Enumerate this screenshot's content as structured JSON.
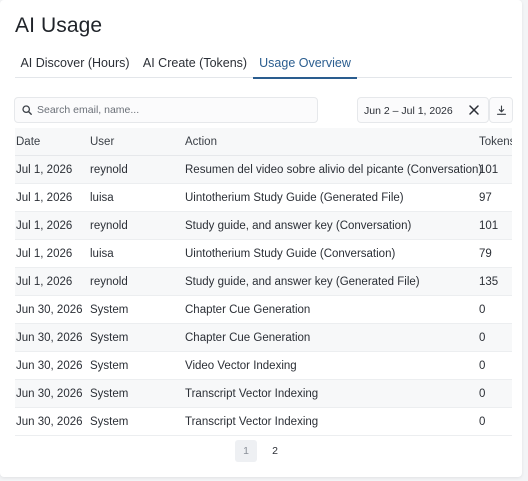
{
  "page": {
    "title": "AI Usage"
  },
  "tabs": [
    {
      "label": "AI Discover (Hours)"
    },
    {
      "label": "AI Create (Tokens)"
    },
    {
      "label": "Usage Overview"
    }
  ],
  "search": {
    "placeholder": "Search email, name..."
  },
  "date_range": {
    "value": "Jun 2 – Jul 1, 2026"
  },
  "table": {
    "headers": {
      "date": "Date",
      "user": "User",
      "action": "Action",
      "tokens": "Tokens"
    },
    "rows": [
      {
        "date": "Jul 1, 2026",
        "user": "reynold",
        "action": "Resumen del video sobre alivio del picante (Conversation)",
        "tokens": "101"
      },
      {
        "date": "Jul 1, 2026",
        "user": "luisa",
        "action": "Uintotherium Study Guide (Generated File)",
        "tokens": "97"
      },
      {
        "date": "Jul 1, 2026",
        "user": "reynold",
        "action": "Study guide,          and answer key (Conversation)",
        "tokens": "101"
      },
      {
        "date": "Jul 1, 2026",
        "user": "luisa",
        "action": "Uintotherium Study Guide (Conversation)",
        "tokens": "79"
      },
      {
        "date": "Jul 1, 2026",
        "user": "reynold",
        "action": "Study guide,          and answer key (Generated File)",
        "tokens": "135"
      },
      {
        "date": "Jun 30, 2026",
        "user": "System",
        "action": "Chapter Cue Generation",
        "tokens": "0"
      },
      {
        "date": "Jun 30, 2026",
        "user": "System",
        "action": "Chapter Cue Generation",
        "tokens": "0"
      },
      {
        "date": "Jun 30, 2026",
        "user": "System",
        "action": "Video Vector Indexing",
        "tokens": "0"
      },
      {
        "date": "Jun 30, 2026",
        "user": "System",
        "action": "Transcript Vector Indexing",
        "tokens": "0"
      },
      {
        "date": "Jun 30, 2026",
        "user": "System",
        "action": "Transcript Vector Indexing",
        "tokens": "0"
      }
    ]
  },
  "pagination": {
    "pages": [
      "1",
      "2"
    ],
    "current": "1"
  },
  "colors": {
    "accent": "#2a5d8f",
    "row_alt": "#f7f8f9",
    "border": "#e6e8eb"
  },
  "icons": {
    "search": "search-icon",
    "clear": "close-icon",
    "download": "download-icon"
  }
}
